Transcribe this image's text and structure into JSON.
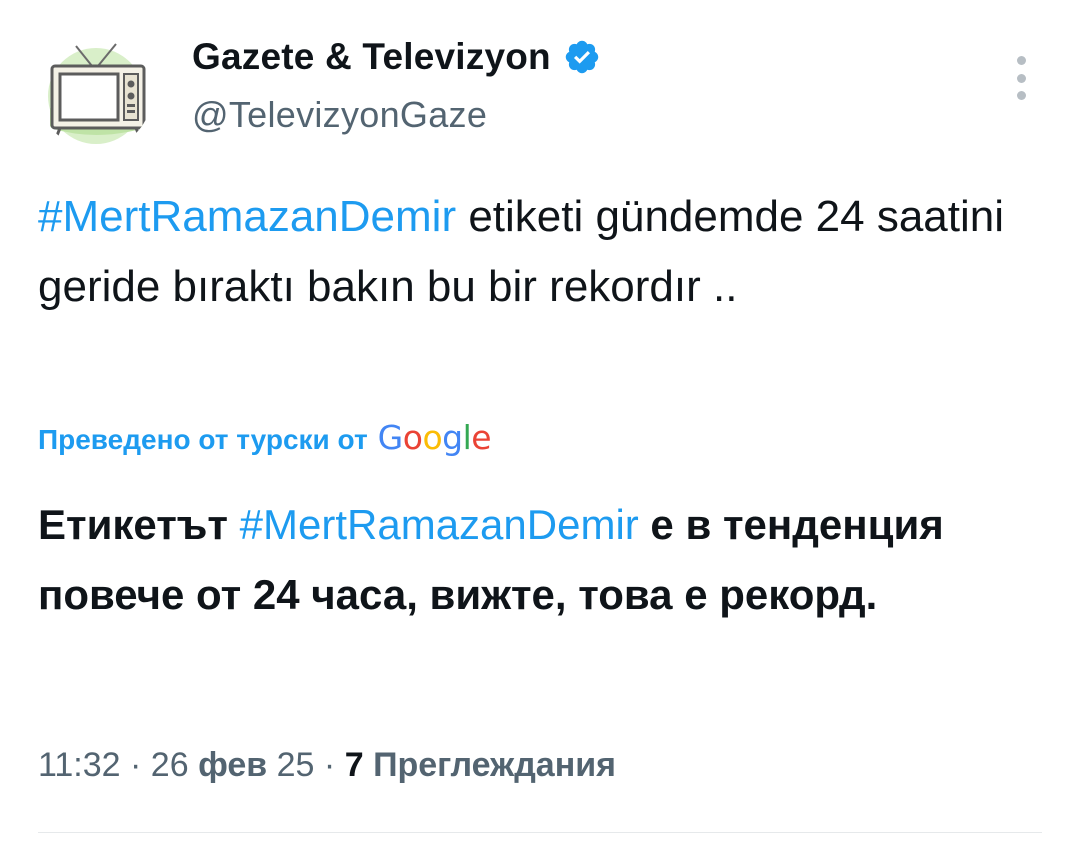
{
  "author": {
    "display_name": "Gazete & Televizyon",
    "handle": "@TelevizyonGaze",
    "verified": true
  },
  "tweet": {
    "hashtag": "#MertRamazanDemir",
    "text_rest": " etiketi gündemde 24 saatini geride bıraktı bakın bu bir rekordır ..",
    "translated_by_label": "Преведено от турски от",
    "translation_provider": "Google",
    "translation_prefix": "Етикетът ",
    "translation_hashtag": "#MertRamazanDemir",
    "translation_rest": " е в тенденция повече от 24 часа, вижте, това е рекорд."
  },
  "meta": {
    "time": "11:32",
    "separator": " · ",
    "date_day": "26",
    "date_month": "фев",
    "date_year": "25",
    "views_count": "7",
    "views_label": "Преглеждания"
  },
  "colors": {
    "accent": "#1d9bf0",
    "text": "#0f1419",
    "secondary": "#536471",
    "verified_badge": "#1d9bf0",
    "google_blue": "#4285f4",
    "google_red": "#ea4335",
    "google_yellow": "#fbbc05",
    "google_green": "#34a853"
  },
  "icons": {
    "avatar": "tv-set-icon",
    "verified": "verified-badge-icon",
    "more": "more-vertical-icon"
  }
}
